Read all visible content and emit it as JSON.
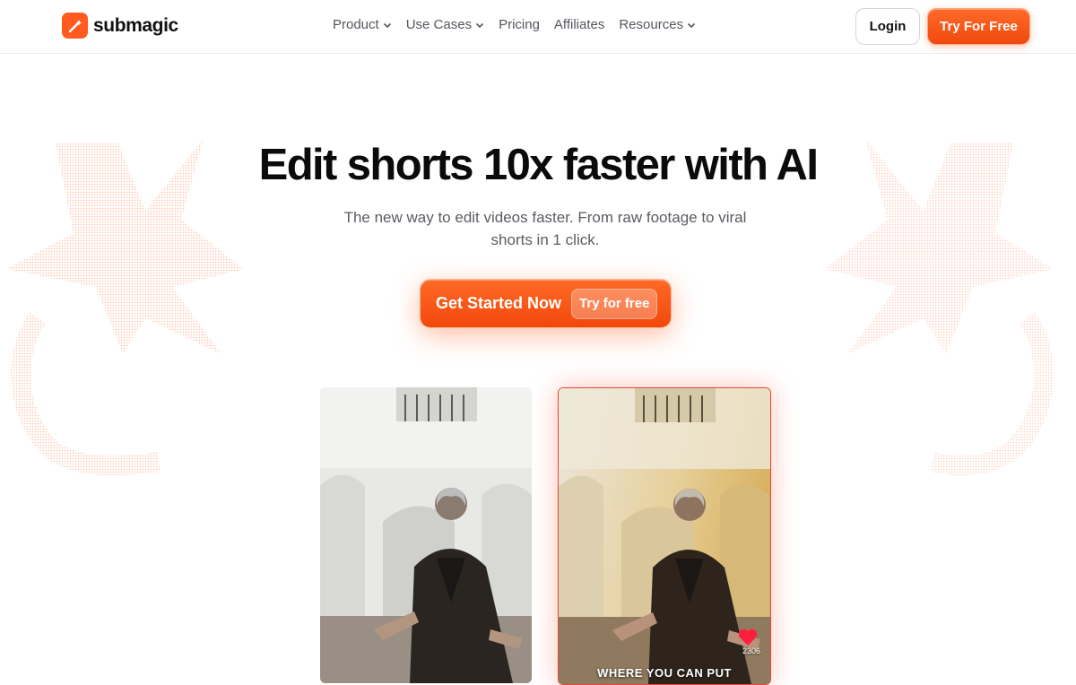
{
  "brand": {
    "name": "submagic",
    "accent": "#ff5a1f"
  },
  "nav": {
    "links": [
      {
        "label": "Product",
        "dropdown": true
      },
      {
        "label": "Use Cases",
        "dropdown": true
      },
      {
        "label": "Pricing",
        "dropdown": false
      },
      {
        "label": "Affiliates",
        "dropdown": false
      },
      {
        "label": "Resources",
        "dropdown": true
      }
    ],
    "login_label": "Login",
    "try_label": "Try For Free"
  },
  "hero": {
    "title": "Edit shorts 10x faster with AI",
    "subtitle": "The new way to edit videos faster. From raw footage to viral shorts in 1 click.",
    "cta_label": "Get Started Now",
    "cta_badge": "Try for free"
  },
  "videos": {
    "after": {
      "likes": "2306",
      "caption": "WHERE YOU CAN PUT"
    }
  }
}
